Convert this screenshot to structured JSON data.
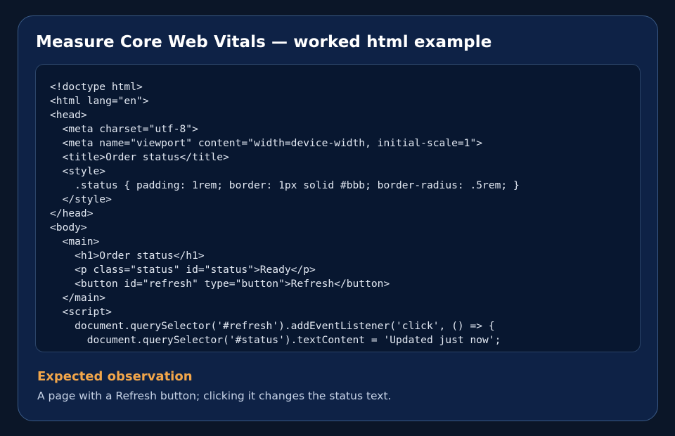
{
  "card": {
    "title": "Measure Core Web Vitals — worked html example"
  },
  "code": {
    "lines": [
      "<!doctype html>",
      "<html lang=\"en\">",
      "<head>",
      "  <meta charset=\"utf-8\">",
      "  <meta name=\"viewport\" content=\"width=device-width, initial-scale=1\">",
      "  <title>Order status</title>",
      "  <style>",
      "    .status { padding: 1rem; border: 1px solid #bbb; border-radius: .5rem; }",
      "  </style>",
      "</head>",
      "<body>",
      "  <main>",
      "    <h1>Order status</h1>",
      "    <p class=\"status\" id=\"status\">Ready</p>",
      "    <button id=\"refresh\" type=\"button\">Refresh</button>",
      "  </main>",
      "  <script>",
      "    document.querySelector('#refresh').addEventListener('click', () => {",
      "      document.querySelector('#status').textContent = 'Updated just now';"
    ]
  },
  "observation": {
    "heading": "Expected observation",
    "text": "A page with a Refresh button; clicking it changes the status text."
  },
  "colors": {
    "page_background": "#0b1628",
    "card_background": "#0e2246",
    "code_background": "#081730",
    "heading_accent": "#f2a64a"
  }
}
